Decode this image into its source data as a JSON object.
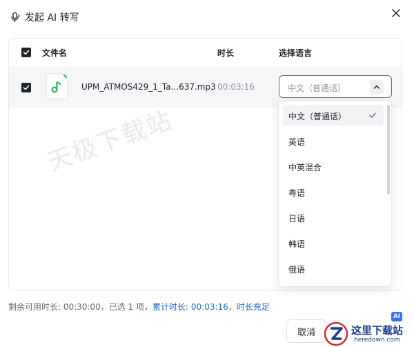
{
  "dialog": {
    "title": "发起 AI 转写",
    "close_icon": "close-icon"
  },
  "table": {
    "headers": {
      "file_name": "文件名",
      "duration": "时长",
      "language": "选择语言"
    },
    "select_all_checked": true,
    "rows": [
      {
        "checked": true,
        "file_icon": "music-file-icon",
        "file_name": "UPM_ATMOS429_1_Ta...637.mp3",
        "duration": "00:03:16",
        "language": "中文（普通话）"
      }
    ]
  },
  "language_dropdown": {
    "open": true,
    "selected_index": 0,
    "options": [
      "中文（普通话）",
      "英语",
      "中英混合",
      "粤语",
      "日语",
      "韩语",
      "俄语"
    ]
  },
  "watermark": "天极下载站",
  "footer": {
    "remaining": "剩余可用时长: 00:30:00，已选 1 项，",
    "cumulative": "累计时长: 00:03:16，时长充足",
    "ai_badge": "AI"
  },
  "buttons": {
    "cancel": "取消"
  },
  "logo": {
    "title": "这里下载站",
    "url": "heredown.com"
  },
  "colors": {
    "accent_blue": "#1a67d4",
    "check_green": "#2fb35f",
    "text_primary": "#1f2329",
    "text_secondary": "#8f959e"
  }
}
